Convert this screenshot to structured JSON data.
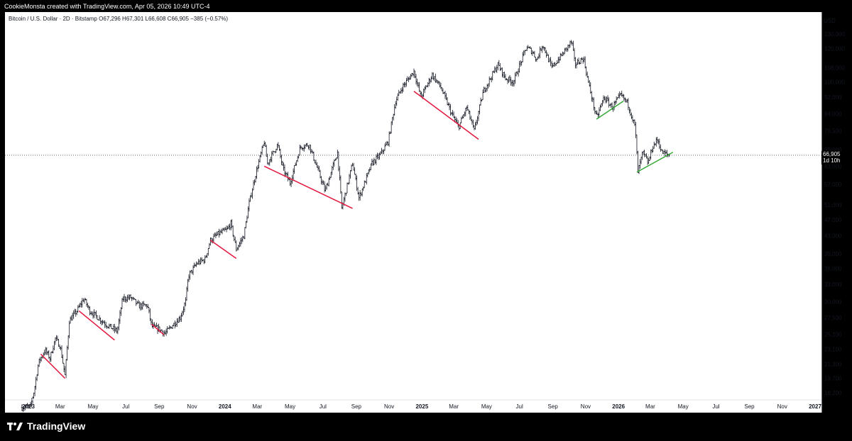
{
  "header": {
    "credit": "CookieMonsta created with TradingView.com, Apr 05, 2026 10:49 UTC-4"
  },
  "legend": {
    "text": "Bitcoin / U.S. Dollar · 2D · Bitstamp  O67,296  H67,301  L66,608  C66,905  −385 (−0.57%)"
  },
  "brand": {
    "name": "TradingView"
  },
  "colors": {
    "up": "#26a69a",
    "down": "#ef5350",
    "candle": "#131722",
    "red_line": "#e3173e",
    "green_line": "#34a835",
    "axis_text": "#131722"
  },
  "chart_data": {
    "type": "candlestick",
    "title": "Bitcoin / U.S. Dollar · 2D · Bitstamp",
    "y_axis_label": "USD",
    "y_scale": "log",
    "y_ticks": [
      18200,
      19700,
      21300,
      23100,
      25100,
      27500,
      30000,
      33000,
      36000,
      39000,
      43000,
      47000,
      51000,
      57000,
      63000,
      69000,
      76500,
      84000,
      92000,
      100000,
      108000,
      120000,
      130000
    ],
    "x_ticks": [
      "2023",
      "Mar",
      "May",
      "Jul",
      "Sep",
      "Nov",
      "2024",
      "Mar",
      "May",
      "Jul",
      "Sep",
      "Nov",
      "2025",
      "Mar",
      "May",
      "Jul",
      "Sep",
      "Nov",
      "2026",
      "Mar",
      "May",
      "Jul",
      "Sep",
      "Nov",
      "2027"
    ],
    "x_tick_dates": [
      "2023-01-01",
      "2023-03-01",
      "2023-05-01",
      "2023-07-01",
      "2023-09-01",
      "2023-11-01",
      "2024-01-01",
      "2024-03-01",
      "2024-05-01",
      "2024-07-01",
      "2024-09-01",
      "2024-11-01",
      "2025-01-01",
      "2025-03-01",
      "2025-05-01",
      "2025-07-01",
      "2025-09-01",
      "2025-11-01",
      "2026-01-01",
      "2026-03-01",
      "2026-05-01",
      "2026-07-01",
      "2026-09-01",
      "2026-11-01",
      "2027-01-01"
    ],
    "last_price": {
      "value": "66,905",
      "countdown": "1d 10h"
    },
    "price_path": [
      [
        "2022-12-20",
        16800
      ],
      [
        "2023-01-05",
        16900
      ],
      [
        "2023-01-12",
        18500
      ],
      [
        "2023-01-20",
        21500
      ],
      [
        "2023-02-01",
        23000
      ],
      [
        "2023-02-10",
        22000
      ],
      [
        "2023-02-20",
        24500
      ],
      [
        "2023-03-01",
        23500
      ],
      [
        "2023-03-10",
        20000
      ],
      [
        "2023-03-18",
        27000
      ],
      [
        "2023-04-01",
        28500
      ],
      [
        "2023-04-14",
        30500
      ],
      [
        "2023-04-25",
        28500
      ],
      [
        "2023-05-10",
        27500
      ],
      [
        "2023-05-25",
        26500
      ],
      [
        "2023-06-15",
        25500
      ],
      [
        "2023-06-25",
        30500
      ],
      [
        "2023-07-10",
        30700
      ],
      [
        "2023-07-25",
        29300
      ],
      [
        "2023-08-10",
        29400
      ],
      [
        "2023-08-18",
        26200
      ],
      [
        "2023-09-01",
        25800
      ],
      [
        "2023-09-12",
        25200
      ],
      [
        "2023-09-25",
        26300
      ],
      [
        "2023-10-10",
        27500
      ],
      [
        "2023-10-20",
        30000
      ],
      [
        "2023-10-25",
        34500
      ],
      [
        "2023-11-10",
        37000
      ],
      [
        "2023-11-25",
        37800
      ],
      [
        "2023-12-05",
        42000
      ],
      [
        "2023-12-20",
        43500
      ],
      [
        "2024-01-05",
        44500
      ],
      [
        "2024-01-12",
        46000
      ],
      [
        "2024-01-22",
        40000
      ],
      [
        "2024-02-05",
        43000
      ],
      [
        "2024-02-15",
        51500
      ],
      [
        "2024-02-28",
        61000
      ],
      [
        "2024-03-14",
        72000
      ],
      [
        "2024-03-20",
        64000
      ],
      [
        "2024-04-08",
        71000
      ],
      [
        "2024-04-18",
        62000
      ],
      [
        "2024-05-01",
        57500
      ],
      [
        "2024-05-20",
        70000
      ],
      [
        "2024-06-05",
        71000
      ],
      [
        "2024-06-25",
        60000
      ],
      [
        "2024-07-05",
        55000
      ],
      [
        "2024-07-28",
        68000
      ],
      [
        "2024-08-05",
        50000
      ],
      [
        "2024-08-25",
        64000
      ],
      [
        "2024-09-06",
        53000
      ],
      [
        "2024-09-30",
        64000
      ],
      [
        "2024-10-15",
        67000
      ],
      [
        "2024-10-30",
        72000
      ],
      [
        "2024-11-13",
        90000
      ],
      [
        "2024-11-25",
        97000
      ],
      [
        "2024-12-17",
        106000
      ],
      [
        "2024-12-30",
        92000
      ],
      [
        "2025-01-20",
        104000
      ],
      [
        "2025-02-05",
        97000
      ],
      [
        "2025-02-25",
        84000
      ],
      [
        "2025-03-10",
        78000
      ],
      [
        "2025-03-25",
        87000
      ],
      [
        "2025-04-08",
        76500
      ],
      [
        "2025-04-25",
        95000
      ],
      [
        "2025-05-22",
        110000
      ],
      [
        "2025-06-05",
        102000
      ],
      [
        "2025-06-20",
        100000
      ],
      [
        "2025-07-14",
        121000
      ],
      [
        "2025-07-25",
        118000
      ],
      [
        "2025-08-02",
        113000
      ],
      [
        "2025-08-13",
        123000
      ],
      [
        "2025-08-30",
        108000
      ],
      [
        "2025-09-20",
        117000
      ],
      [
        "2025-10-06",
        125000
      ],
      [
        "2025-10-12",
        110000
      ],
      [
        "2025-10-28",
        114000
      ],
      [
        "2025-11-05",
        101000
      ],
      [
        "2025-11-21",
        82000
      ],
      [
        "2025-12-05",
        92000
      ],
      [
        "2025-12-20",
        87000
      ],
      [
        "2026-01-05",
        93000
      ],
      [
        "2026-01-18",
        89000
      ],
      [
        "2026-02-01",
        78000
      ],
      [
        "2026-02-06",
        61000
      ],
      [
        "2026-02-15",
        68000
      ],
      [
        "2026-02-25",
        64000
      ],
      [
        "2026-03-05",
        70000
      ],
      [
        "2026-03-15",
        73000
      ],
      [
        "2026-03-22",
        68000
      ],
      [
        "2026-04-05",
        66905
      ]
    ],
    "trendlines": [
      {
        "color": "red",
        "from": [
          "2023-01-24",
          22500
        ],
        "to": [
          "2023-03-10",
          19700
        ]
      },
      {
        "color": "red",
        "from": [
          "2023-04-05",
          28500
        ],
        "to": [
          "2023-06-10",
          24300
        ]
      },
      {
        "color": "red",
        "from": [
          "2023-08-18",
          26500
        ],
        "to": [
          "2023-09-10",
          25000
        ]
      },
      {
        "color": "red",
        "from": [
          "2023-12-05",
          42000
        ],
        "to": [
          "2024-01-22",
          38000
        ]
      },
      {
        "color": "red",
        "from": [
          "2024-03-14",
          63000
        ],
        "to": [
          "2024-08-25",
          50000
        ]
      },
      {
        "color": "red",
        "from": [
          "2024-12-17",
          95000
        ],
        "to": [
          "2025-04-16",
          73000
        ]
      },
      {
        "color": "green",
        "from": [
          "2025-11-21",
          81500
        ],
        "to": [
          "2026-01-10",
          90000
        ]
      },
      {
        "color": "green",
        "from": [
          "2026-02-04",
          61000
        ],
        "to": [
          "2026-04-12",
          68000
        ]
      }
    ]
  }
}
